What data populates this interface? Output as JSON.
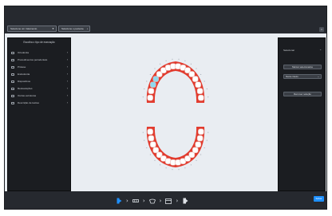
{
  "topbar": {
    "select_1": "Selecione um tratamento",
    "select_2": "Selecione o paciente",
    "corner_icon": "expand-icon"
  },
  "left_panel": {
    "title": "Escolha o tipo de marcação",
    "items": [
      {
        "label": "Ortodontia",
        "icon": "bracket-icon"
      },
      {
        "label": "Procedimentos periodontais",
        "icon": "gum-icon"
      },
      {
        "label": "Prótese",
        "icon": "crown-icon"
      },
      {
        "label": "Endodontia",
        "icon": "root-icon"
      },
      {
        "label": "Dispositivos",
        "icon": "device-icon"
      },
      {
        "label": "Restaurações",
        "icon": "filling-icon"
      },
      {
        "label": "Outras estruturas",
        "icon": "structure-icon"
      },
      {
        "label": "Descrição de lesões",
        "icon": "lesion-icon"
      }
    ]
  },
  "right_panel": {
    "header": "Selecionar",
    "button_1": "Marcar selecionados",
    "select_value": "Dente inteiro",
    "button_2": "Remover seleção"
  },
  "bottombar": {
    "steps": [
      "tooth-icon",
      "braces-icon",
      "implant-icon",
      "panel-icon",
      "export-icon"
    ],
    "save_label": "Salvar"
  },
  "colors": {
    "accent": "#1e90ff",
    "gum": "#e23b2e",
    "tooth_selected": "#8fd9ee",
    "panel": "#1b1d21"
  }
}
